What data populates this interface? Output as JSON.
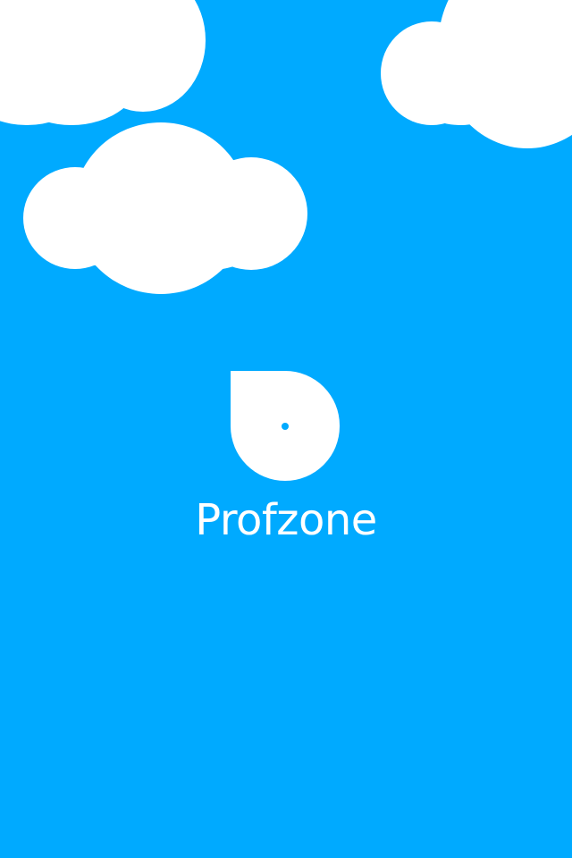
{
  "app": {
    "name": "Profzone"
  },
  "logo": {
    "icon": "profzone-logo-icon"
  },
  "decorations": {
    "clouds": [
      "cloud-icon",
      "cloud-icon",
      "cloud-icon"
    ]
  },
  "colors": {
    "background": "#00aaff",
    "foreground": "#ffffff",
    "accent_dot": "#00aaff"
  }
}
